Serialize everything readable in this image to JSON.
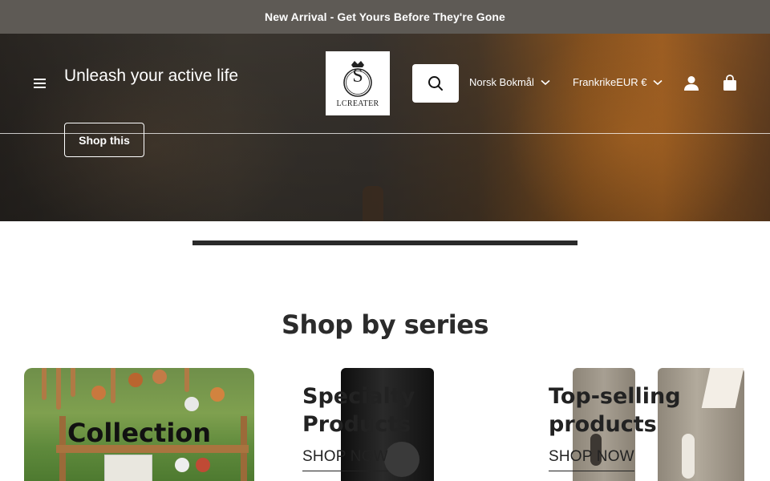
{
  "announcement": {
    "text": "New Arrival - Get Yours Before They're Gone"
  },
  "header": {
    "tagline": "Unleash your active life",
    "logo_text": "LCREATER",
    "logo_letter": "S",
    "language": "Norsk Bokmål",
    "country": "Frankrike",
    "currency": "EUR €"
  },
  "hero": {
    "cta_label": "Shop this"
  },
  "slider": {
    "progress": 1.0
  },
  "series": {
    "title": "Shop by series",
    "cards": [
      {
        "title": "Collection"
      },
      {
        "title": "Specialty Products",
        "link": "SHOP NOW"
      },
      {
        "title": "Top-selling products",
        "link": "SHOP NOW"
      }
    ]
  },
  "colors": {
    "announcement_bg": "#5e5a55",
    "text_dark": "#222222",
    "white": "#ffffff"
  },
  "icons": [
    "menu-icon",
    "search-icon",
    "chevron-down-icon",
    "account-icon",
    "cart-icon"
  ]
}
